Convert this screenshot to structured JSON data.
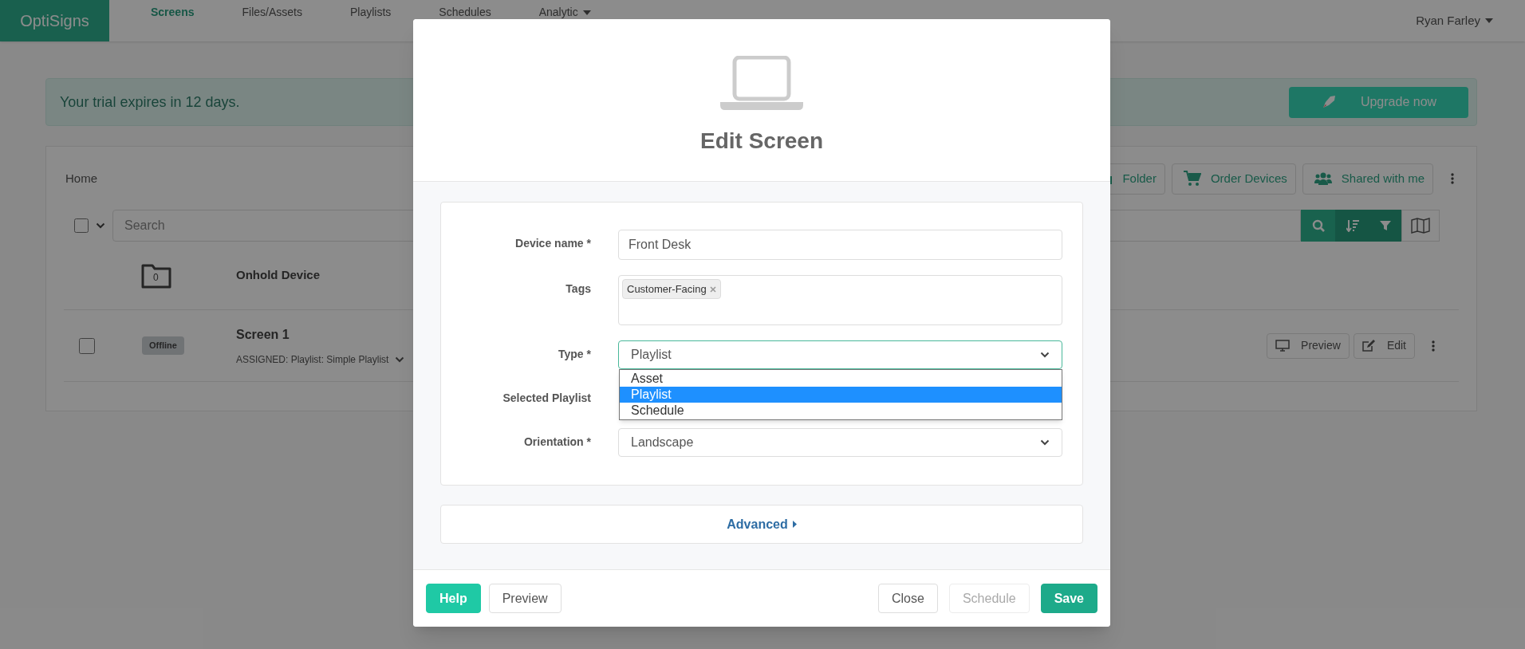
{
  "navbar": {
    "brand": "OptiSigns",
    "items": [
      {
        "label": "Screens",
        "selected": true,
        "dropdown": false
      },
      {
        "label": "Files/Assets",
        "selected": false,
        "dropdown": false
      },
      {
        "label": "Playlists",
        "selected": false,
        "dropdown": false
      },
      {
        "label": "Schedules",
        "selected": false,
        "dropdown": false
      },
      {
        "label": "Analytic",
        "selected": false,
        "dropdown": true
      }
    ],
    "user": "Ryan Farley"
  },
  "trial_banner": {
    "message": "Your trial expires in 12 days.",
    "button": "Upgrade now"
  },
  "screens_panel": {
    "breadcrumb": "Home",
    "toolbar_buttons": [
      {
        "label": "Folder",
        "kind": "folder"
      },
      {
        "label": "Order Devices",
        "kind": "cart"
      },
      {
        "label": "Shared with me",
        "kind": "users"
      }
    ],
    "select_all": {
      "checked": false
    },
    "search": {
      "placeholder": "Search"
    },
    "folders": [
      {
        "name": "Onhold Device",
        "count": "0"
      }
    ],
    "screens": [
      {
        "name": "Screen 1",
        "status": "Offline",
        "assigned": "ASSIGNED: Playlist: Simple Playlist",
        "checked": false,
        "actions": [
          {
            "label": "Preview",
            "kind": "monitor"
          },
          {
            "label": "Edit",
            "kind": "edit"
          }
        ]
      }
    ]
  },
  "modal": {
    "title": "Edit Screen",
    "fields": [
      {
        "label": "Device name *",
        "kind": "text",
        "value": "Front Desk"
      },
      {
        "label": "Tags",
        "kind": "tags",
        "tags": [
          "Customer-Facing"
        ]
      },
      {
        "label": "Type *",
        "kind": "select",
        "value": "Playlist",
        "open": true,
        "options": [
          {
            "label": "Asset",
            "selected": false
          },
          {
            "label": "Playlist",
            "selected": true
          },
          {
            "label": "Schedule",
            "selected": false
          }
        ]
      },
      {
        "label": "Selected Playlist",
        "kind": "select"
      },
      {
        "label": "Orientation *",
        "kind": "select",
        "value": "Landscape",
        "open": false
      }
    ],
    "advanced": "Advanced",
    "footer_left": [
      {
        "label": "Help",
        "kind": "accent"
      },
      {
        "label": "Preview",
        "kind": "plain"
      }
    ],
    "footer_right": [
      {
        "label": "Close",
        "kind": "plain"
      },
      {
        "label": "Schedule",
        "kind": "disabled"
      },
      {
        "label": "Save",
        "kind": "primary"
      }
    ]
  }
}
